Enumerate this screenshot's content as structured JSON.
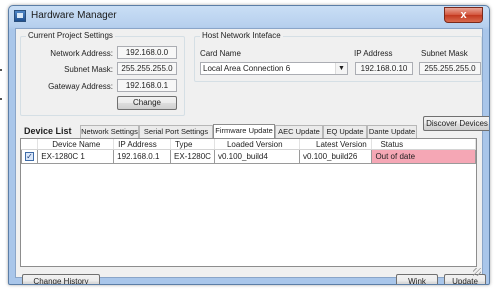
{
  "window": {
    "title": "Hardware Manager",
    "close_glyph": "x"
  },
  "current_project": {
    "title": "Current Project Settings",
    "network_address_label": "Network Address:",
    "network_address": "192.168.0.0",
    "subnet_mask_label": "Subnet Mask:",
    "subnet_mask": "255.255.255.0",
    "gateway_label": "Gateway Address:",
    "gateway": "192.168.0.1",
    "change_label": "Change"
  },
  "host_network": {
    "title": "Host Network Inteface",
    "card_name_label": "Card Name",
    "card_name": "Local Area Connection 6",
    "ip_label": "IP Address",
    "ip": "192.168.0.10",
    "mask_label": "Subnet Mask",
    "mask": "255.255.255.0"
  },
  "device_list": {
    "caption": "Device List",
    "tabs": [
      "Network Settings",
      "Serial Port Settings",
      "Firmware Update",
      "AEC Update",
      "EQ Update",
      "Dante Update"
    ],
    "active_tab": "Firmware Update",
    "discover_label": "Discover Devices",
    "columns": [
      "Device Name",
      "IP Address",
      "Type",
      "Loaded Version",
      "Latest Version",
      "Status"
    ],
    "rows": [
      {
        "checked": true,
        "device_name": "EX-1280C 1",
        "ip": "192.168.0.1",
        "type": "EX-1280C",
        "loaded": "v0.100_build4",
        "latest": "v0.100_build26",
        "status": "Out of date",
        "status_color": "#f5a7b5"
      }
    ]
  },
  "footer": {
    "change_history_label": "Change History",
    "wink_label": "Wink",
    "update_label": "Update"
  },
  "colors": {
    "out_of_date": "#f5a7b5",
    "title_gradient_top": "#c9def5",
    "close_red": "#c2381f"
  }
}
